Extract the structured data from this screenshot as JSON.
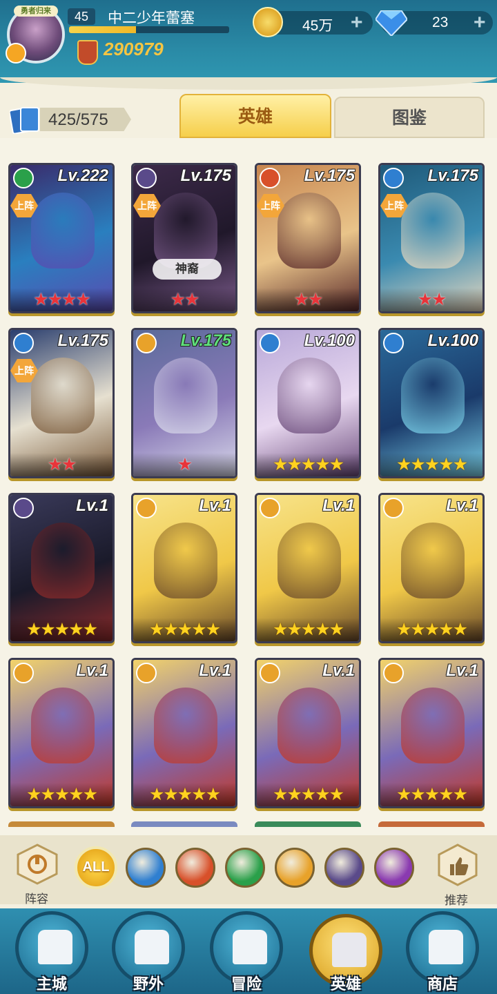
{
  "player": {
    "avatar_badge": "勇者归来",
    "level": "45",
    "name": "中二少年蕾塞",
    "xp_fraction": 0.42,
    "power": "290979"
  },
  "currency": {
    "gold": "45万",
    "gems": "23",
    "plus_label": "+"
  },
  "hero_count": "425/575",
  "tabs": {
    "heroes": "英雄",
    "gallery": "图鉴"
  },
  "heroes": [
    {
      "level": "Lv.222",
      "element": "wind",
      "deployed": true,
      "tag": "",
      "stars": 4,
      "star_color": "red",
      "palette": [
        "#3a2a6a",
        "#5a4bb0",
        "#2a7fbf"
      ]
    },
    {
      "level": "Lv.175",
      "element": "dark",
      "deployed": true,
      "tag": "神裔",
      "stars": 2,
      "star_color": "red",
      "palette": [
        "#3d2a4a",
        "#7a5a8a",
        "#20182a"
      ]
    },
    {
      "level": "Lv.175",
      "element": "fire",
      "deployed": true,
      "tag": "",
      "stars": 2,
      "star_color": "red",
      "palette": [
        "#c7854f",
        "#5a2a2a",
        "#e9c48a"
      ]
    },
    {
      "level": "Lv.175",
      "element": "water",
      "deployed": true,
      "tag": "",
      "stars": 2,
      "star_color": "red",
      "palette": [
        "#1f5a7a",
        "#e6d8c0",
        "#3a8ab0"
      ]
    },
    {
      "level": "Lv.175",
      "element": "water",
      "deployed": true,
      "tag": "",
      "stars": 2,
      "star_color": "red",
      "palette": [
        "#2a3e6e",
        "#7a5a3a",
        "#e6e0d0"
      ]
    },
    {
      "level": "Lv.175",
      "element": "light",
      "deployed": false,
      "tag": "",
      "stars": 1,
      "star_color": "red",
      "palette": [
        "#5a6a9a",
        "#d8d8ea",
        "#8a7ab8"
      ],
      "level_color": "green"
    },
    {
      "level": "Lv.100",
      "element": "water",
      "deployed": false,
      "tag": "",
      "stars": 5,
      "star_color": "gold",
      "palette": [
        "#b8a8d8",
        "#6a4a7a",
        "#e8d8f0"
      ]
    },
    {
      "level": "Lv.100",
      "element": "water",
      "deployed": false,
      "tag": "",
      "stars": 5,
      "star_color": "gold",
      "palette": [
        "#2a6a9a",
        "#7ad0e8",
        "#1a3a6a"
      ]
    },
    {
      "level": "Lv.1",
      "element": "dark",
      "deployed": false,
      "tag": "",
      "stars": 5,
      "star_color": "gold",
      "palette": [
        "#3a3a5a",
        "#8a2a2a",
        "#1a1a2a"
      ]
    },
    {
      "level": "Lv.1",
      "element": "light",
      "deployed": false,
      "tag": "",
      "stars": 5,
      "star_color": "gold",
      "palette": [
        "#f7e38a",
        "#6a4a2a",
        "#f0c848"
      ]
    },
    {
      "level": "Lv.1",
      "element": "light",
      "deployed": false,
      "tag": "",
      "stars": 5,
      "star_color": "gold",
      "palette": [
        "#f7e38a",
        "#6a4a2a",
        "#f0c848"
      ]
    },
    {
      "level": "Lv.1",
      "element": "light",
      "deployed": false,
      "tag": "",
      "stars": 5,
      "star_color": "gold",
      "palette": [
        "#f7e38a",
        "#6a4a2a",
        "#f0c848"
      ]
    },
    {
      "level": "Lv.1",
      "element": "light",
      "deployed": false,
      "tag": "",
      "stars": 5,
      "star_color": "gold",
      "palette": [
        "#f3d36a",
        "#c23a2a",
        "#7a6ab8"
      ]
    },
    {
      "level": "Lv.1",
      "element": "light",
      "deployed": false,
      "tag": "",
      "stars": 5,
      "star_color": "gold",
      "palette": [
        "#f3d36a",
        "#c23a2a",
        "#7a6ab8"
      ]
    },
    {
      "level": "Lv.1",
      "element": "light",
      "deployed": false,
      "tag": "",
      "stars": 5,
      "star_color": "gold",
      "palette": [
        "#f3d36a",
        "#c23a2a",
        "#7a6ab8"
      ]
    },
    {
      "level": "Lv.1",
      "element": "light",
      "deployed": false,
      "tag": "",
      "stars": 5,
      "star_color": "gold",
      "palette": [
        "#f3d36a",
        "#c23a2a",
        "#7a6ab8"
      ]
    }
  ],
  "deployed_label": "上阵",
  "filters": {
    "lineup": "阵容",
    "recommend": "推荐",
    "all": "ALL",
    "elements": [
      {
        "name": "water",
        "color": "#2f7fd0"
      },
      {
        "name": "fire",
        "color": "#d8502a"
      },
      {
        "name": "wind",
        "color": "#2aa04a"
      },
      {
        "name": "light",
        "color": "#e8a22a"
      },
      {
        "name": "dark",
        "color": "#5a4a8a"
      },
      {
        "name": "chaos",
        "color": "#8a3ab0"
      }
    ]
  },
  "element_colors": {
    "wind": "#2aa04a",
    "dark": "#5a4a8a",
    "fire": "#d8502a",
    "water": "#2f7fd0",
    "light": "#e8a22a"
  },
  "nav": [
    {
      "label": "主城",
      "icon": "castle-icon",
      "selected": false
    },
    {
      "label": "野外",
      "icon": "portal-icon",
      "selected": false
    },
    {
      "label": "冒险",
      "icon": "sword-icon",
      "selected": false
    },
    {
      "label": "英雄",
      "icon": "helmet-icon",
      "selected": true
    },
    {
      "label": "商店",
      "icon": "shop-icon",
      "selected": false
    }
  ]
}
